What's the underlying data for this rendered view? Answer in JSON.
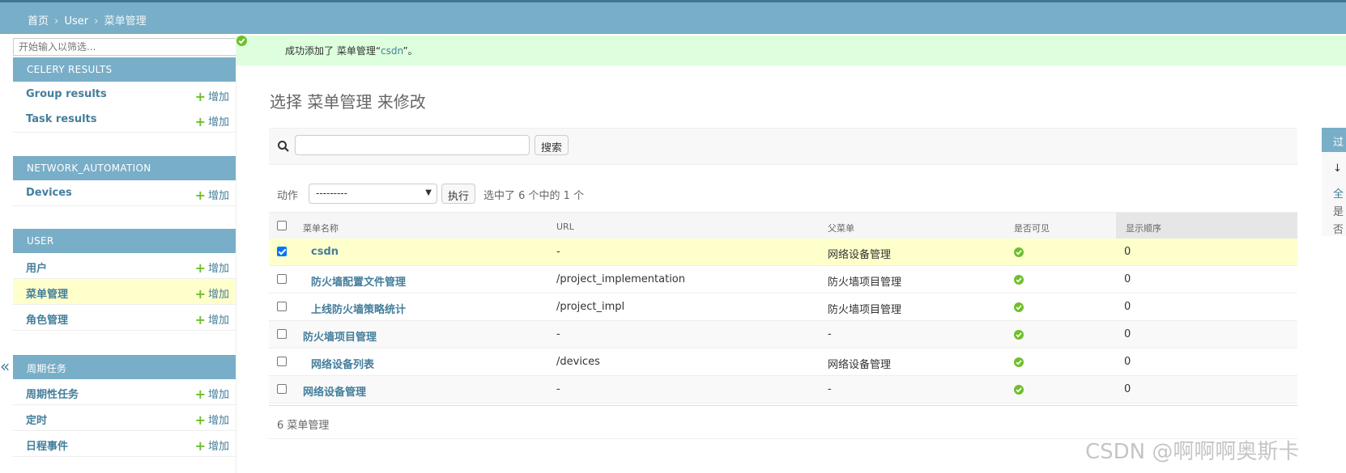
{
  "breadcrumbs": {
    "home": "首页",
    "app": "User",
    "current": "菜单管理",
    "sep": "›"
  },
  "sidebar": {
    "filter_placeholder": "开始输入以筛选...",
    "add_label": "增加",
    "collapse": "«",
    "modules": [
      {
        "caption": "CELERY RESULTS",
        "items": [
          "Group results",
          "Task results"
        ]
      },
      {
        "caption": "NETWORK_AUTOMATION",
        "items": [
          "Devices"
        ]
      },
      {
        "caption": "USER",
        "items": [
          "用户",
          "菜单管理",
          "角色管理"
        ]
      },
      {
        "caption": "周期任务",
        "items": [
          "周期性任务",
          "定时",
          "日程事件"
        ]
      }
    ]
  },
  "message": {
    "prefix": "成功添加了 菜单管理“",
    "link": "csdn",
    "suffix": "”。"
  },
  "page_title": "选择 菜单管理 来修改",
  "search": {
    "button": "搜索"
  },
  "actions": {
    "label": "动作",
    "selected_option": "---------",
    "run_button": "执行",
    "counter": "选中了 6 个中的 1 个"
  },
  "table": {
    "headers": [
      "菜单名称",
      "URL",
      "父菜单",
      "是否可见",
      "显示顺序"
    ],
    "rows": [
      {
        "name": "csdn",
        "url": "-",
        "parent": "网络设备管理",
        "order": "0"
      },
      {
        "name": "防火墙配置文件管理",
        "url": "/project_implementation",
        "parent": "防火墙项目管理",
        "order": "0"
      },
      {
        "name": "上线防火墙策略统计",
        "url": "/project_impl",
        "parent": "防火墙项目管理",
        "order": "0"
      },
      {
        "name": "防火墙项目管理",
        "url": "-",
        "parent": "-",
        "order": "0"
      },
      {
        "name": "网络设备列表",
        "url": "/devices",
        "parent": "网络设备管理",
        "order": "0"
      },
      {
        "name": "网络设备管理",
        "url": "-",
        "parent": "-",
        "order": "0"
      }
    ],
    "count": "6 菜单管理"
  },
  "filter_panel": {
    "title": "过",
    "items": [
      "↓",
      "全",
      "是",
      "否"
    ]
  },
  "watermark": "CSDN @啊啊啊奥斯卡",
  "colors": {
    "header": "#79aec8",
    "link": "#447e9b",
    "success_bg": "#ddffdd",
    "selected_row": "#ffffcc",
    "add_plus": "#70bf2b"
  }
}
